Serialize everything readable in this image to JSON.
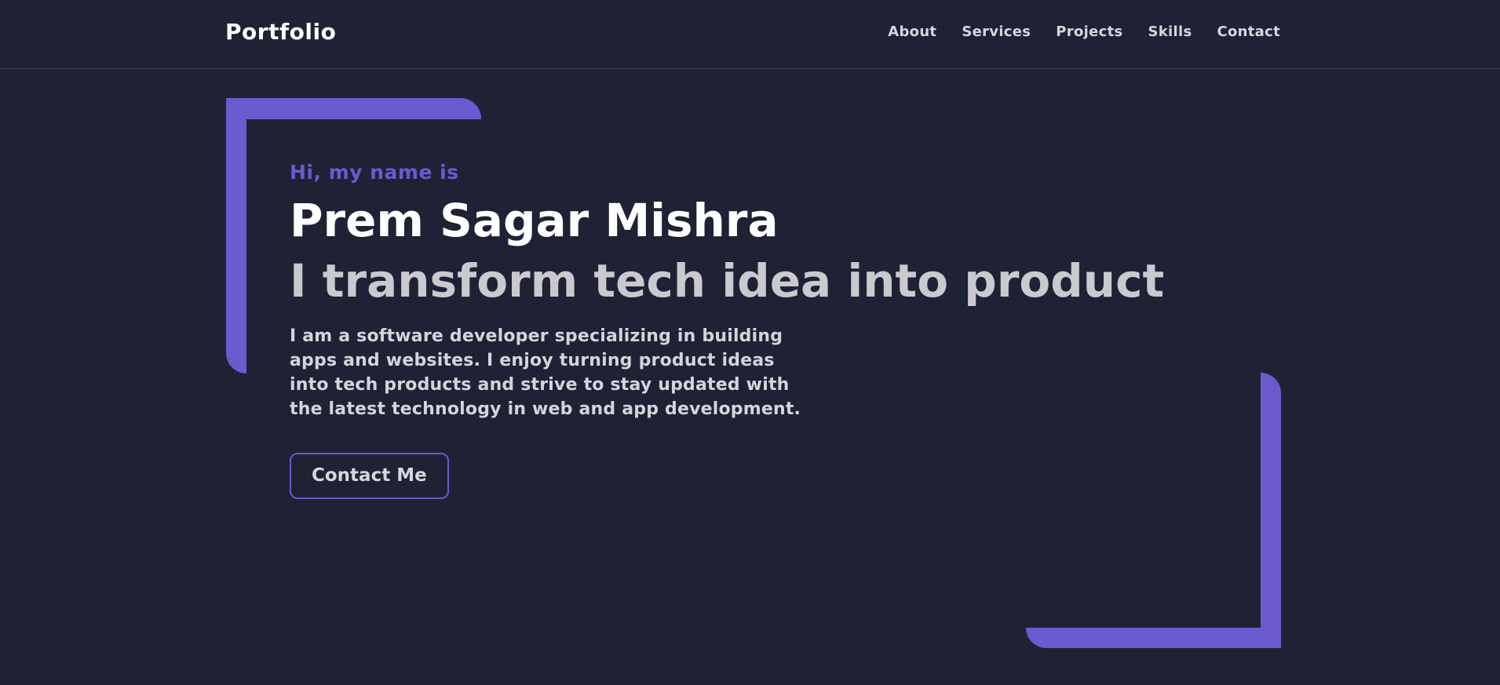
{
  "header": {
    "logo": "Portfolio",
    "nav": [
      {
        "label": "About"
      },
      {
        "label": "Services"
      },
      {
        "label": "Projects"
      },
      {
        "label": "Skills"
      },
      {
        "label": "Contact"
      }
    ]
  },
  "hero": {
    "greeting": "Hi, my name is",
    "name": "Prem Sagar Mishra",
    "tagline": "I transform tech idea into product",
    "description": "I am a software developer specializing in building apps and websites. I enjoy turning product ideas into tech products and strive to stay updated with the latest technology in web and app development.",
    "cta_label": "Contact Me"
  },
  "colors": {
    "background": "#1f2235",
    "accent": "#6a5acd",
    "heading": "#ffffff",
    "text": "#d4d4da"
  }
}
